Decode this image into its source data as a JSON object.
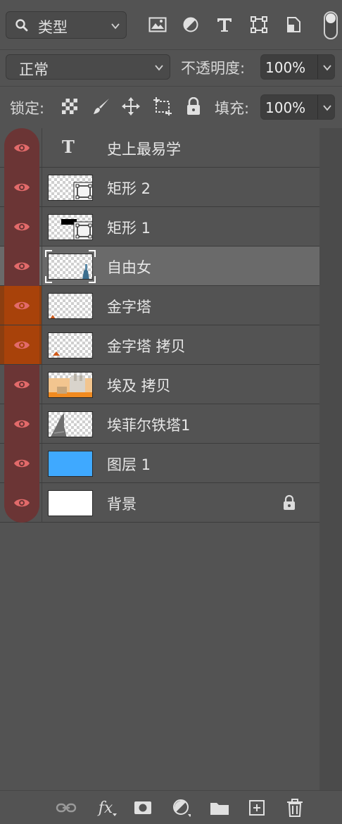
{
  "filter": {
    "kind_label": "类型",
    "icons": [
      "image-filter-icon",
      "adjustment-filter-icon",
      "type-filter-icon",
      "shape-filter-icon",
      "smart-object-filter-icon"
    ]
  },
  "blend": {
    "mode": "正常",
    "opacity_label": "不透明度:",
    "opacity_value": "100%"
  },
  "lock": {
    "label": "锁定:",
    "fill_label": "填充:",
    "fill_value": "100%"
  },
  "layers": [
    {
      "name": "史上最易学",
      "kind": "text",
      "visible": true
    },
    {
      "name": "矩形 2",
      "kind": "shape",
      "visible": true
    },
    {
      "name": "矩形 1",
      "kind": "shape",
      "visible": true
    },
    {
      "name": "自由女",
      "kind": "smart",
      "visible": true,
      "selected": true
    },
    {
      "name": "金字塔",
      "kind": "raster",
      "visible": true,
      "highlight": "orange"
    },
    {
      "name": "金字塔 拷贝",
      "kind": "raster",
      "visible": true,
      "highlight": "orange"
    },
    {
      "name": "埃及 拷贝",
      "kind": "raster",
      "visible": true
    },
    {
      "name": "埃菲尔铁塔1",
      "kind": "raster",
      "visible": true
    },
    {
      "name": "图层 1",
      "kind": "fill",
      "visible": true,
      "color": "#3fa9ff"
    },
    {
      "name": "背景",
      "kind": "background",
      "visible": true,
      "locked": true
    }
  ],
  "colors": {
    "eye_column": "#6b3535",
    "orange_highlight": "#a8420a",
    "eye": "#e26a6a"
  },
  "bottom_icons": [
    "link-layers-icon",
    "fx-icon",
    "add-mask-icon",
    "adjustment-layer-icon",
    "new-group-icon",
    "new-layer-icon",
    "delete-layer-icon"
  ]
}
